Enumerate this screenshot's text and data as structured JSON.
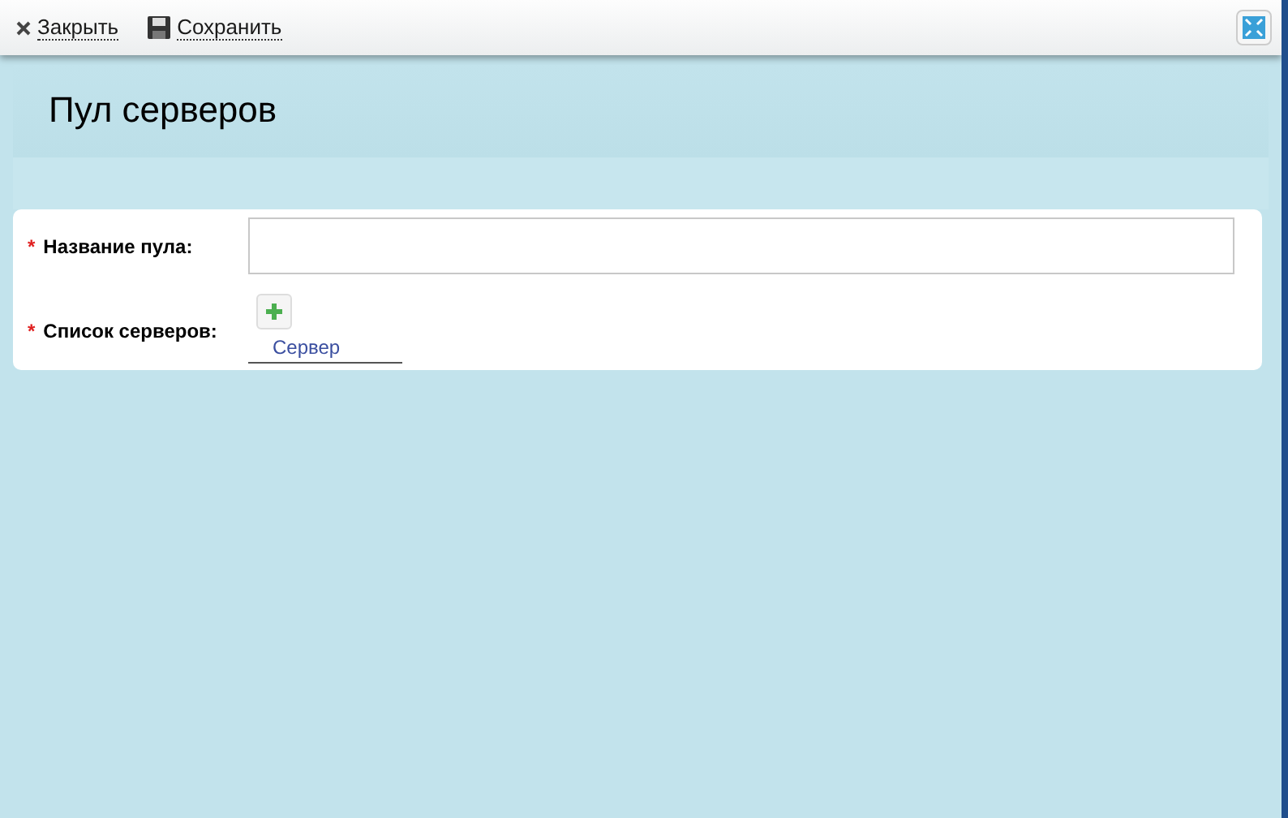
{
  "toolbar": {
    "actions": [
      {
        "kind": "close",
        "label": "Закрыть"
      },
      {
        "kind": "save",
        "label": "Сохранить"
      }
    ]
  },
  "title": "Пул серверов",
  "form": {
    "fields": [
      {
        "kind": "text",
        "label": "Название пула:",
        "required": true,
        "required_mark": "*"
      },
      {
        "kind": "list",
        "label": "Список серверов:",
        "required": true,
        "required_mark": "*",
        "columns": [
          "Сервер"
        ]
      }
    ]
  }
}
